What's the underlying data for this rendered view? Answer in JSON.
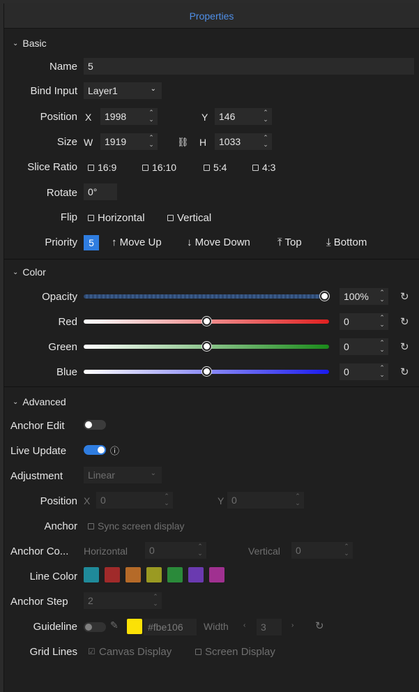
{
  "title": "Properties",
  "basic": {
    "header": "Basic",
    "name_label": "Name",
    "name_value": "5",
    "bind_label": "Bind Input",
    "bind_value": "Layer1",
    "position_label": "Position",
    "pos_x_label": "X",
    "pos_x": "1998",
    "pos_y_label": "Y",
    "pos_y": "146",
    "size_label": "Size",
    "size_w_label": "W",
    "size_w": "1919",
    "size_h_label": "H",
    "size_h": "1033",
    "slice_label": "Slice Ratio",
    "slice_options": [
      "16:9",
      "16:10",
      "5:4",
      "4:3"
    ],
    "rotate_label": "Rotate",
    "rotate_value": "0°",
    "flip_label": "Flip",
    "flip_h": "Horizontal",
    "flip_v": "Vertical",
    "priority_label": "Priority",
    "priority_value": "5",
    "move_up": "↑ Move Up",
    "move_down": "↓ Move Down",
    "top": "⤒ Top",
    "bottom": "⤓ Bottom"
  },
  "color": {
    "header": "Color",
    "opacity_label": "Opacity",
    "opacity_value": "100%",
    "opacity_level": 1.0,
    "red_label": "Red",
    "red_value": "0",
    "green_label": "Green",
    "green_value": "0",
    "blue_label": "Blue",
    "blue_value": "0",
    "channel_level": 0.5,
    "colors": {
      "red": "#e02020",
      "green": "#1a8a1a",
      "blue": "#1a1aee"
    }
  },
  "advanced": {
    "header": "Advanced",
    "anchor_edit_label": "Anchor Edit",
    "anchor_edit_on": false,
    "live_update_label": "Live Update",
    "live_update_on": true,
    "info_icon": "info-icon",
    "adjustment_label": "Adjustment",
    "adjustment_value": "Linear",
    "position_label": "Position",
    "pos_x_label": "X",
    "pos_x": "0",
    "pos_y_label": "Y",
    "pos_y": "0",
    "anchor_label": "Anchor",
    "sync_screen": "Sync screen display",
    "anchor_co_label": "Anchor Co...",
    "horizontal_label": "Horizontal",
    "horizontal_value": "0",
    "vertical_label": "Vertical",
    "vertical_value": "0",
    "line_color_label": "Line Color",
    "line_colors": [
      "#1f8a9a",
      "#a02a2a",
      "#b56a28",
      "#9a9a22",
      "#2a8a3a",
      "#6a3ab0",
      "#a03090"
    ],
    "anchor_step_label": "Anchor Step",
    "anchor_step_value": "2",
    "guideline_label": "Guideline",
    "guideline_color": "#fbe106",
    "guideline_hex": "#fbe106",
    "width_label": "Width",
    "width_value": "3",
    "grid_lines_label": "Grid Lines",
    "canvas_display": "Canvas Display",
    "screen_display": "Screen Display"
  }
}
